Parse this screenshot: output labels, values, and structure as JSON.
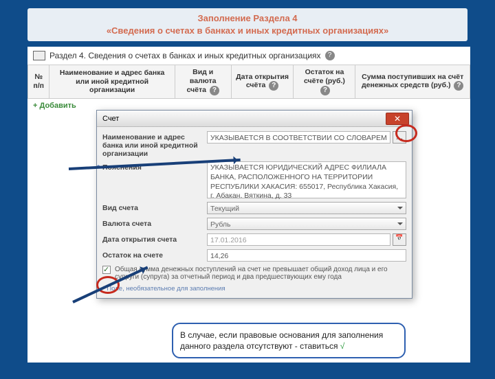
{
  "slide": {
    "title_line1": "Заполнение Раздела 4",
    "title_line2": "«Сведения о счетах в банках и иных кредитных организациях»"
  },
  "section": {
    "title": "Раздел 4. Сведения о счетах в банках и иных кредитных организациях"
  },
  "columns": {
    "c0": "№ п/п",
    "c1": "Наименование и адрес банка или иной кредитной организации",
    "c2": "Вид и валюта счёта",
    "c3": "Дата открытия счёта",
    "c4": "Остаток на счёте (руб.)",
    "c5": "Сумма поступивших на счёт денежных средств (руб.)"
  },
  "add_button": "+ Добавить",
  "dialog": {
    "title": "Счет",
    "labels": {
      "bank": "Наименование и адрес банка или иной кредитной организации",
      "notes": "Пояснения",
      "type": "Вид счета",
      "currency": "Валюта счета",
      "open_date": "Дата открытия счета",
      "balance": "Остаток на счете"
    },
    "values": {
      "bank": "УКАЗЫВАЕТСЯ  В СООТВЕТСТВИИ СО СЛОВАРЕМ",
      "notes": "УКАЗЫВАЕТСЯ ЮРИДИЧЕСКИЙ АДРЕС ФИЛИАЛА БАНКА, РАСПОЛОЖЕННОГО НА ТЕРРИТОРИИ РЕСПУБЛИКИ ХАКАСИЯ: 655017, Республика Хакасия, г. Абакан. Вяткина, д. 33",
      "type": "Текущий",
      "currency": "Рубль",
      "open_date": "17.01.2016",
      "balance": "14,26"
    },
    "checkbox_label": "Общая сумма денежных поступлений на счет не превышает общий доход лица и его супруги (супруга) за отчетный период и два предшествующих ему года",
    "footnote": "*  Поле, необязательное для заполнения"
  },
  "callout": {
    "text": "В случае, если правовые основания для заполнения данного раздела отсутствуют - ставиться ",
    "mark": "√"
  }
}
